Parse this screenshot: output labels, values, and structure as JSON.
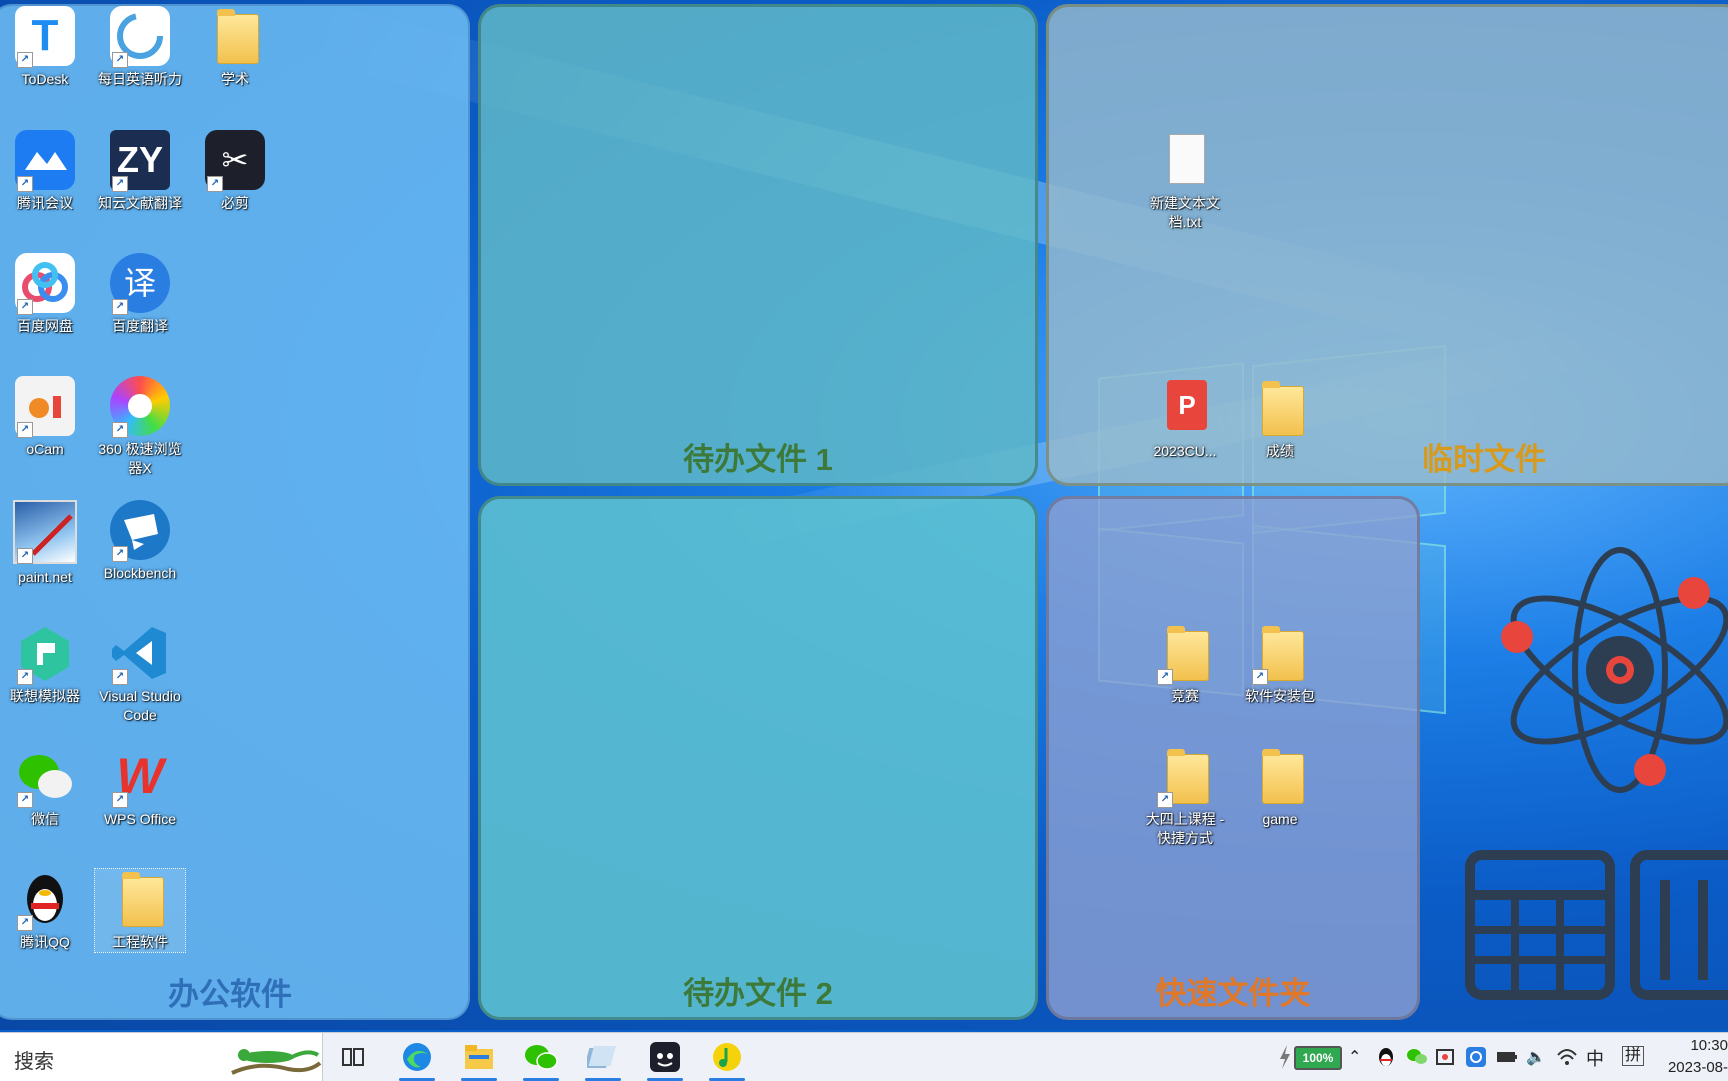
{
  "fences": {
    "office": "办公软件",
    "todo1": "待办文件 1",
    "todo2": "待办文件 2",
    "temp": "临时文件",
    "quick": "快速文件夹"
  },
  "icons": {
    "todesk": "ToDesk",
    "daily_english": "每日英语听力",
    "academic": "学术",
    "tencent_meeting": "腾讯会议",
    "zhiyun": "知云文献翻译",
    "bijian": "必剪",
    "baidu_pan": "百度网盘",
    "baidu_fanyi": "百度翻译",
    "ocam": "oCam",
    "browser360": "360 极速浏览器X",
    "paintnet": "paint.net",
    "blockbench": "Blockbench",
    "lenovo_emu": "联想模拟器",
    "vscode": "Visual Studio Code",
    "wechat": "微信",
    "wps": "WPS Office",
    "qq": "腾讯QQ",
    "engineering": "工程软件",
    "new_txt": "新建文本文档.txt",
    "pdf_2023": "2023CU...",
    "grades": "成绩",
    "contest": "竞赛",
    "software_pkg": "软件安装包",
    "senior_course": "大四上课程 - 快捷方式",
    "game": "game"
  },
  "icon_glyphs": {
    "todesk": "T",
    "zhiyun": "ZY",
    "baidu_fanyi": "译",
    "qq": "🐧",
    "wps": "W",
    "wechat": "💬",
    "bijian": "✂",
    "vscode": "⟩⟨"
  },
  "taskbar": {
    "search_placeholder": "搜索",
    "battery": "100%",
    "ime_lang": "中",
    "ime_mode": "拼",
    "time": "10:30",
    "date": "2023-08-"
  },
  "colors": {
    "office_title": "#2f6fb8",
    "todo_title": "#3d7a3a",
    "temp_title": "#d79a1c",
    "quick_title": "#e0782a"
  }
}
